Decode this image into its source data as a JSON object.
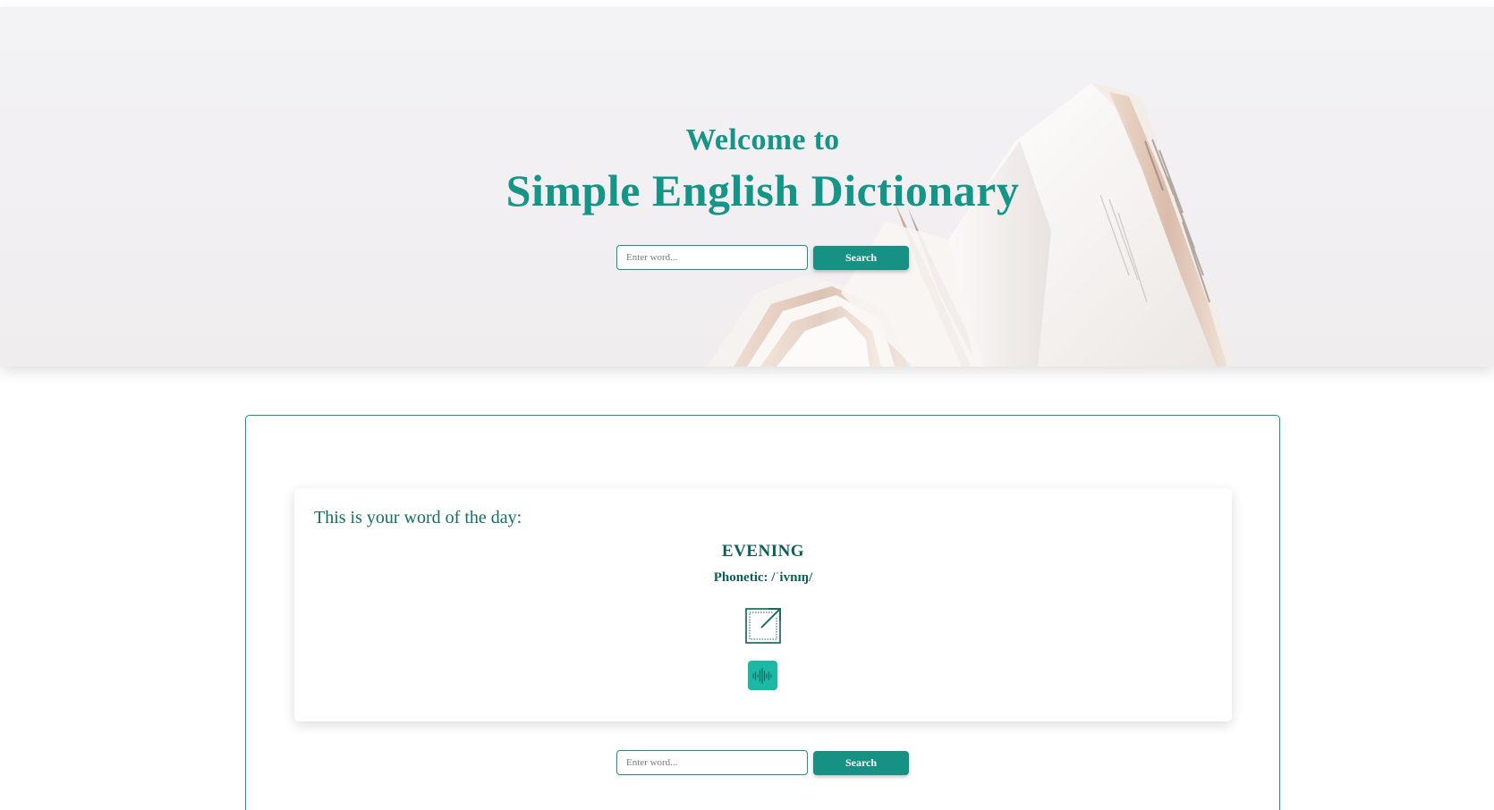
{
  "hero": {
    "welcome": "Welcome to",
    "title": "Simple English Dictionary",
    "search": {
      "placeholder": "Enter word...",
      "button_label": "Search"
    }
  },
  "word_of_day": {
    "heading": "This is your word of the day:",
    "word": "EVENING",
    "phonetic": "Phonetic: /ˈivnɪŋ/",
    "link_icon": "external-link-icon",
    "audio_icon": "audio-waveform-icon"
  },
  "lower_search": {
    "placeholder": "Enter word...",
    "button_label": "Search"
  },
  "colors": {
    "accent": "#159488",
    "button": "#169183",
    "audio_button": "#1bb8a5",
    "heading_text": "#0f6e66"
  }
}
